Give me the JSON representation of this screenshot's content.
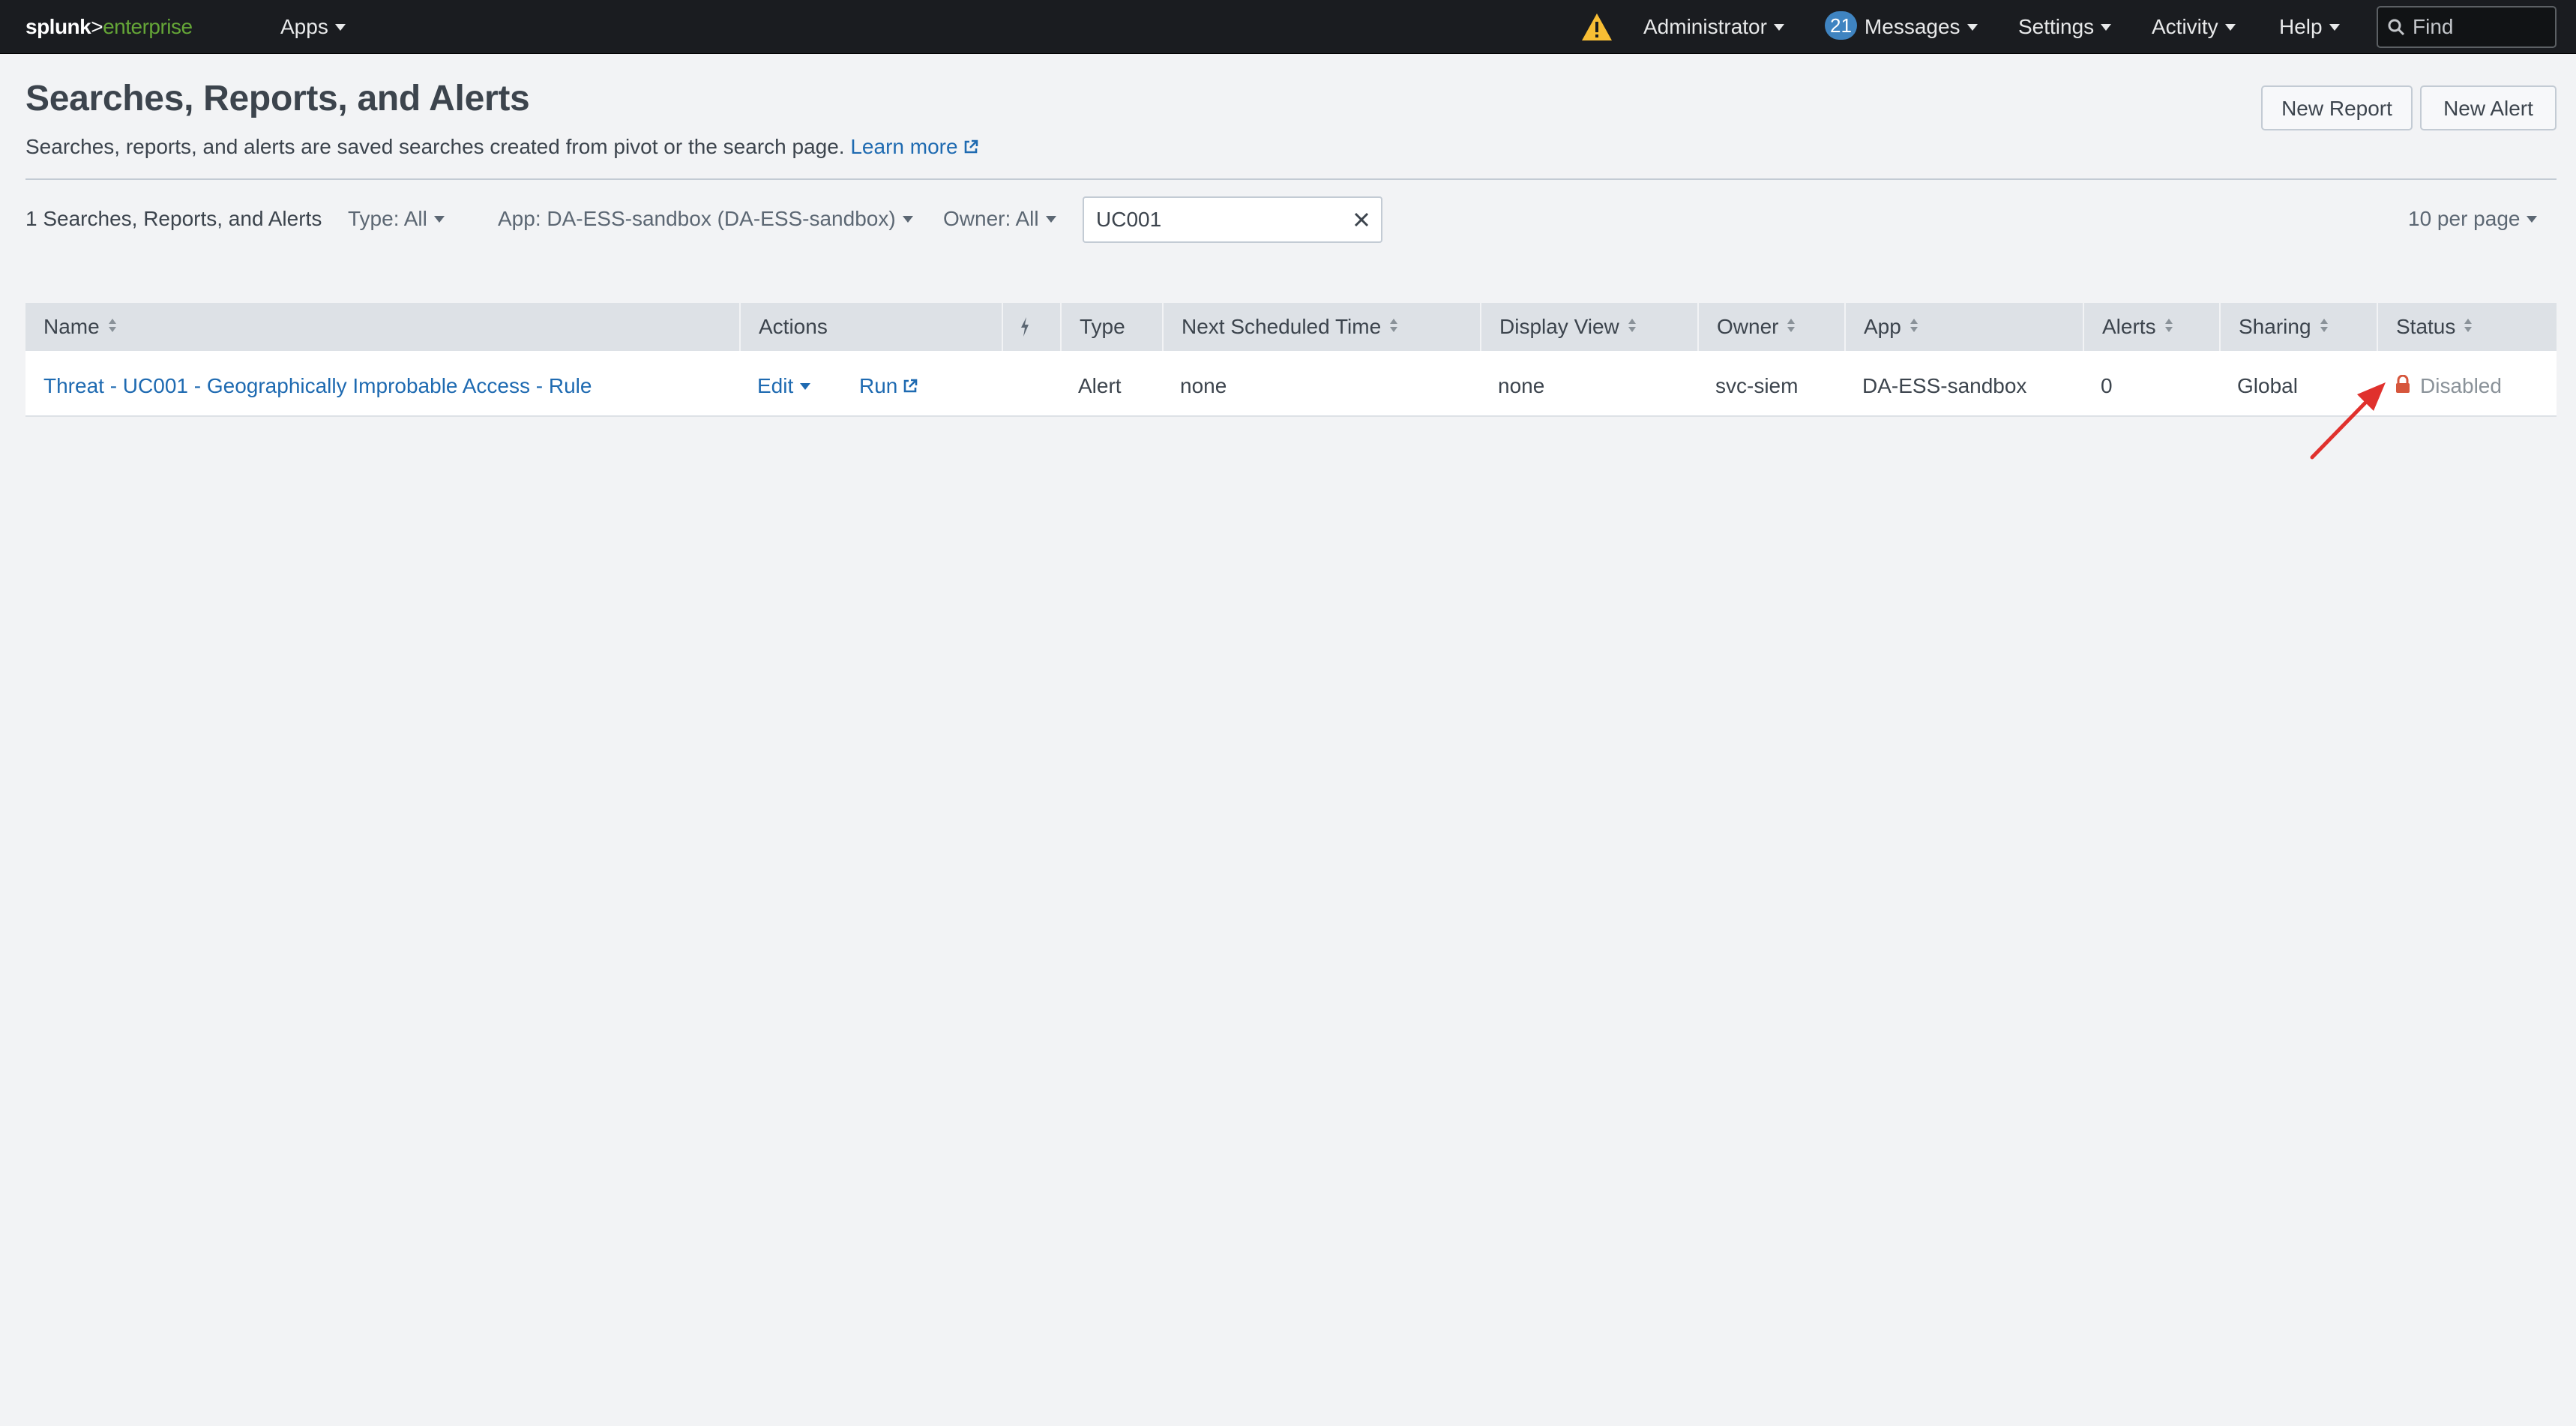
{
  "topbar": {
    "logo_part1": "splunk",
    "logo_part2": ">",
    "logo_part3": "enterprise",
    "apps": "Apps",
    "administrator": "Administrator",
    "messages_count": "21",
    "messages": "Messages",
    "settings": "Settings",
    "activity": "Activity",
    "help": "Help",
    "find_placeholder": "Find",
    "icons": [
      "warning-icon",
      "search-icon"
    ]
  },
  "header": {
    "title": "Searches, Reports, and Alerts",
    "description": "Searches, reports, and alerts are saved searches created from pivot or the search page.",
    "learn_more": "Learn more",
    "new_report": "New Report",
    "new_alert": "New Alert"
  },
  "filters": {
    "count_label": "1 Searches, Reports, and Alerts",
    "type": "Type: All",
    "app": "App: DA-ESS-sandbox (DA-ESS-sandbox)",
    "owner": "Owner: All",
    "search_value": "UC001",
    "per_page": "10 per page"
  },
  "table": {
    "columns": {
      "name": "Name",
      "actions": "Actions",
      "type": "Type",
      "next_scheduled": "Next Scheduled Time",
      "display_view": "Display View",
      "owner": "Owner",
      "app": "App",
      "alerts": "Alerts",
      "sharing": "Sharing",
      "status": "Status"
    },
    "rows": [
      {
        "name": "Threat - UC001 - Geographically Improbable Access - Rule",
        "edit": "Edit",
        "run": "Run",
        "type": "Alert",
        "next_scheduled": "none",
        "display_view": "none",
        "owner": "svc-siem",
        "app": "DA-ESS-sandbox",
        "alerts": "0",
        "sharing": "Global",
        "status": "Disabled"
      }
    ]
  },
  "colors": {
    "topbar_bg": "#1a1c20",
    "link": "#1e6ab1",
    "brand_green": "#65a637",
    "badge_blue": "#3f84c1",
    "warning_yellow": "#f8be34",
    "lock_red": "#d6563c",
    "annotation_red": "#e0312d"
  }
}
